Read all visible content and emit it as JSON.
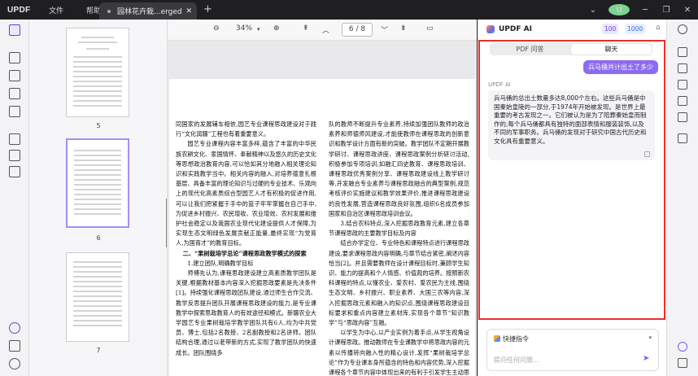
{
  "app": {
    "logo": "UPDF",
    "menu": [
      "文件",
      "帮助"
    ]
  },
  "tab": {
    "label": "园林花卉栽...erged",
    "add": "+"
  },
  "toolbar": {
    "zoom_out": "⊖",
    "zoom": "34%",
    "zoom_in": "⊕",
    "page_current": "6",
    "page_total": "8",
    "page_display": "6 / 8"
  },
  "thumbnails": [
    {
      "page": "5"
    },
    {
      "page": "6"
    },
    {
      "page": "7"
    }
  ],
  "document": {
    "left_column": [
      {
        "type": "noindent",
        "text": "同国家的发展辅车相依,园艺专业课程思政建设对于践行“文化润疆”工程也有着重要意义。"
      },
      {
        "type": "p",
        "text": "园艺专业课程内容丰富多样,蕴含了丰富的中华民族农耕文化、家国情怀、奉献精神以及悠久的历史文化等思想政治教育内容,可以恰如其分地融入相关理论知识和实践教学当中。相关内容的融入,对培养德意扎根基层、具备丰富的理论知识与过硬的专业技术、乐观向上的现代化高素质综合型园艺人才有积极的促进作用,可以让我们把紧握于手中的篮子牢牢掌握在自己手中,为促进乡村振兴、农民增收、农业增效、农村发展和维护社会稳定以及我国农业现代化建设提供人才保障,为实现生态文明绿色发展贡献正能量,最终实现“为党育人,为国育才”的教育目标。"
      },
      {
        "type": "heading",
        "text": "二、“果树栽培学总论”课程思政教学模式的探索"
      },
      {
        "type": "p",
        "text": "1.建立团队,明确教学目标"
      },
      {
        "type": "p",
        "text": "师傅先认为,课程思政建设建立高素质教学团队是关键,根据教材基本内容深入挖掘思政要素是先决条件[1]。持续强化课程思政团队建设,通过师生合作交流、教学反思提升团队开展课程思政建设的能力,是专业课教学中探索思政教育人的有效途径和模式。新疆农业大学园艺专业果树栽培学教学团队共有6人,均为中共党员、博士,包括2名教授、2名副教授和2名讲师。团队结构合理,通过以老带新的方式,实现了教学团队的快速成长。团队围绕多"
      }
    ],
    "right_column": [
      {
        "type": "noindent",
        "text": "队的教师不断提升专业素养,持续加强团队教师的政治素养和师德师风建设,才能使教师在课程思政的创新意识和教学设计方面有新的突破。教学团队不定期开展教学研讨、课程思政讲座、课程思政案例分析研讨活动,积极参加专项培训,如融汇四史教育、课程思政培训、课程思政优秀案例分享、课程思政建设线上教学研讨等,开发融合专业素养与课程思政融合的典型案例,规范考核评价实施建议和教学效果评价,推进课程思政建设的良性发展,营造课程思政良好氛围,组织6名成员参加国家和自治区课程思政培训会议。"
      },
      {
        "type": "p",
        "text": "3.结合农科特点,深入挖掘思政教育元素,建立各章节课程思政的主要教学目标及内容"
      },
      {
        "type": "p",
        "text": "结合办学定位、专业特色和课程特点进行课程思政建设,要求课程思政内容明确,与章节结合紧密,阐述内容恰当[2]。并且需要教师在设计课程目标时,兼顾学生知识、能力的提高和个人情感、价值观的培养。按照新农科课程的特点,以懂农业、爱农村、爱农民为主线,围绕生态文明、乡村振兴、职业素养、大国三农等内容,深入挖掘思政元素和融入的知识点,围绕课程思政建设目标要求和重点内容建立素材库,实现各个章节“知识教学”与“思政内容”互融。"
      },
      {
        "type": "p",
        "text": "以学生为中心,以产业实例为着手点,从学生视角设计课程思政。推动教师在专业课教学中将思政内容的元素以传播转向融入性的精心设计,发挥“果树栽培学总论”作为专业课本身所蕴含的特色和内容优势,深入挖掘课程各个章节内容中体现出来的有利于引发学生主动思考的思政元素,配合"
      }
    ]
  },
  "ai": {
    "title": "UPDF AI",
    "badge_1": "100",
    "badge_2": "1000",
    "tabs": [
      "PDF 问答",
      "聊天"
    ],
    "active_tab": "聊天",
    "user_question": "兵马俑共计出土了多少",
    "assistant_label": "UPDF AI",
    "answer": "兵马俑的总出土数量多达8,000个左右。这些兵马俑是中国秦始皇陵的一部分,于1974年开始被发现。是世界上最重要的考古发现之一。它们被认为是为了陪葬秦始皇而制作的,每个兵马俑都具有独特的面部表情和服装装饰,以及不同的军事职务。兵马俑的发现对于研究中国古代历史和文化具有重要意义。",
    "quick_label": "快捷指令",
    "input_placeholder": "提问任何问题..."
  },
  "colors": {
    "accent": "#7b5cf0",
    "highlight_frame": "#e8302c",
    "user_bubble": "#8b6cf0"
  }
}
